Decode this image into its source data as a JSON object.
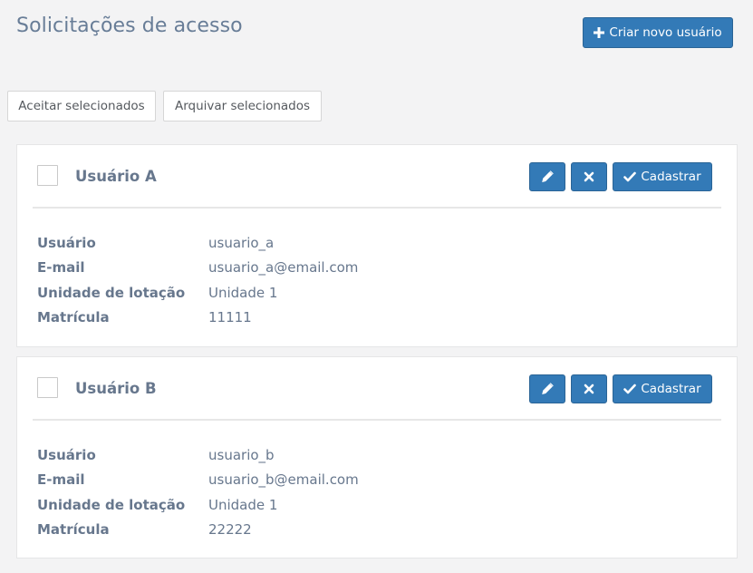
{
  "page": {
    "title": "Solicitações de acesso",
    "create_button": "Criar novo usuário"
  },
  "bulk_actions": {
    "accept_label": "Aceitar selecionados",
    "archive_label": "Arquivar selecionados"
  },
  "colors": {
    "primary": "#337ab7",
    "text": "#67778d",
    "background": "#f3f3f4"
  },
  "requests": [
    {
      "name": "Usuário A",
      "register_label": "Cadastrar",
      "fields": [
        {
          "label": "Usuário",
          "value": "usuario_a"
        },
        {
          "label": "E-mail",
          "value": "usuario_a@email.com"
        },
        {
          "label": "Unidade de lotação",
          "value": "Unidade 1"
        },
        {
          "label": "Matrícula",
          "value": "11111"
        }
      ]
    },
    {
      "name": "Usuário B",
      "register_label": "Cadastrar",
      "fields": [
        {
          "label": "Usuário",
          "value": "usuario_b"
        },
        {
          "label": "E-mail",
          "value": "usuario_b@email.com"
        },
        {
          "label": "Unidade de lotação",
          "value": "Unidade 1"
        },
        {
          "label": "Matrícula",
          "value": "22222"
        }
      ]
    }
  ]
}
